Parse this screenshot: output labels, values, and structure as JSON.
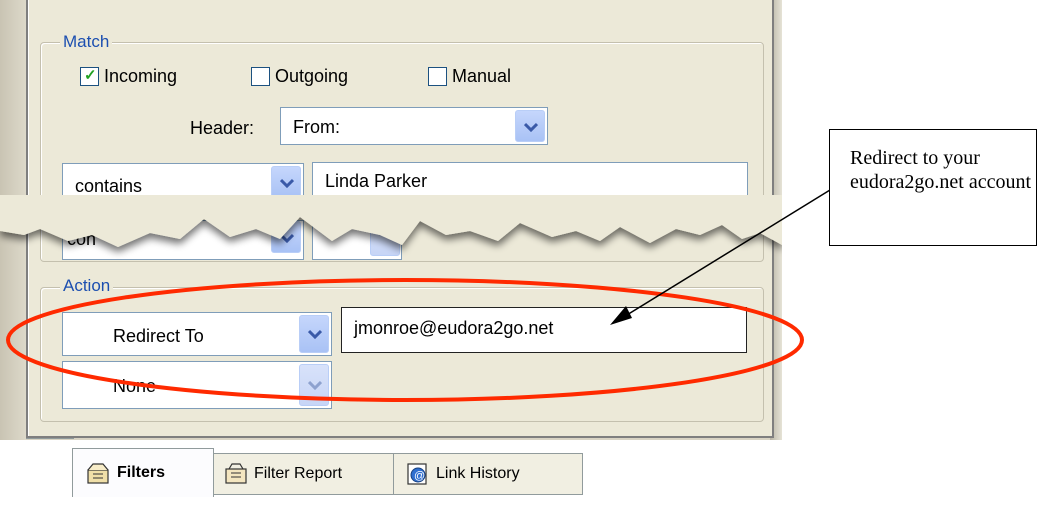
{
  "match": {
    "legend": "Match",
    "incoming": {
      "label": "Incoming",
      "checked": true
    },
    "outgoing": {
      "label": "Outgoing",
      "checked": false
    },
    "manual": {
      "label": "Manual",
      "checked": false
    },
    "header_label": "Header:",
    "header_value": "From:",
    "condition_value": "contains",
    "condition_text": "Linda Parker",
    "torn_condition_value": "con"
  },
  "action": {
    "legend": "Action",
    "action1_value": "Redirect To",
    "action1_text": "jmonroe@eudora2go.net",
    "action2_value": "None"
  },
  "tabs": [
    {
      "label": "Filters",
      "icon": "filters-icon",
      "active": true
    },
    {
      "label": "Filter Report",
      "icon": "filter-report-icon",
      "active": false
    },
    {
      "label": "Link History",
      "icon": "link-history-icon",
      "active": false
    }
  ],
  "annotation": {
    "text": "Redirect to your eudora2go.net account",
    "highlight_color": "#ff2a00"
  }
}
